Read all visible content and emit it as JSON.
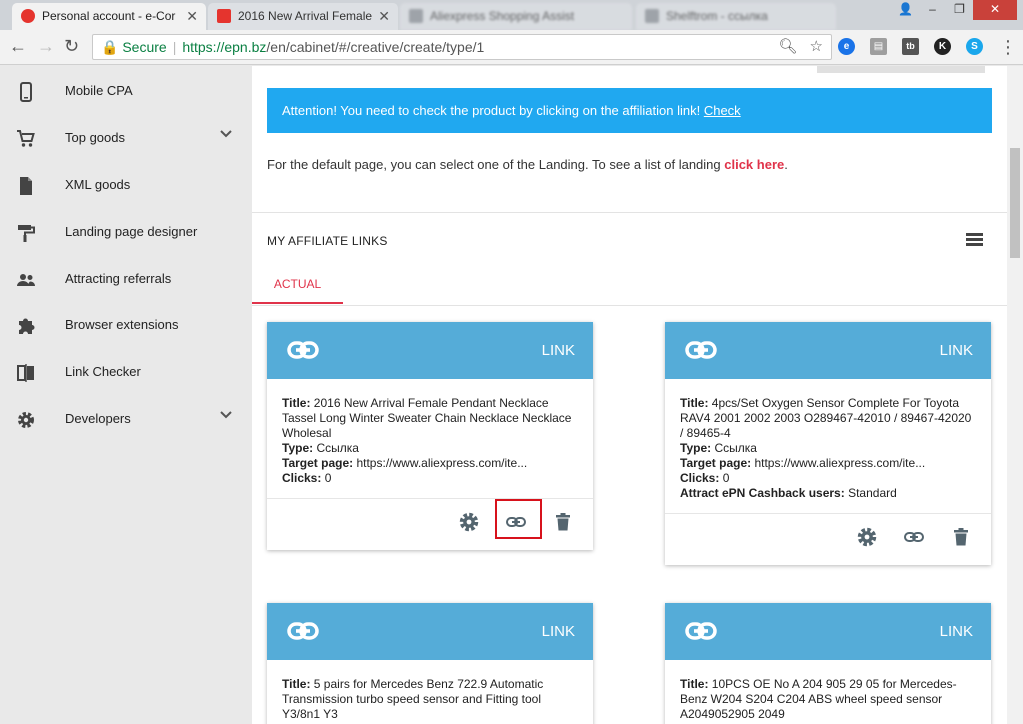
{
  "browser": {
    "tabs": [
      {
        "title": "Personal account - e-Cor",
        "active": true,
        "fav_color": "#e5342e"
      },
      {
        "title": "2016 New Arrival Female",
        "active": false,
        "fav_color": "#e5342e"
      },
      {
        "title": "Aliexpress Shopping Assist",
        "active": false,
        "blurred": true
      },
      {
        "title": "Shelftrom - ссылка",
        "active": false,
        "blurred": true
      }
    ],
    "address": {
      "secure_label": "Secure",
      "url_host": "https://epn.bz",
      "url_path": "/en/cabinet/#/creative/create/type/1"
    },
    "extensions": [
      {
        "name": "e-extension-icon",
        "label": "e",
        "color": "#1a73e8"
      },
      {
        "name": "save-extension-icon",
        "label": "▤",
        "color": "#9e9e9e"
      },
      {
        "name": "tb-extension-icon",
        "label": "tb",
        "color": "#555555"
      },
      {
        "name": "k-extension-icon",
        "label": "K",
        "color": "#222222"
      },
      {
        "name": "skype-extension-icon",
        "label": "S",
        "color": "#1aa7ec"
      }
    ]
  },
  "sidebar": {
    "items": [
      {
        "label": "Mobile CPA",
        "icon": "phone-icon",
        "expandable": false
      },
      {
        "label": "Top goods",
        "icon": "cart-icon",
        "expandable": true
      },
      {
        "label": "XML goods",
        "icon": "file-icon",
        "expandable": false
      },
      {
        "label": "Landing page designer",
        "icon": "paint-roller-icon",
        "expandable": false
      },
      {
        "label": "Attracting referrals",
        "icon": "people-icon",
        "expandable": false
      },
      {
        "label": "Browser extensions",
        "icon": "puzzle-icon",
        "expandable": false
      },
      {
        "label": "Link Checker",
        "icon": "compare-icon",
        "expandable": false
      },
      {
        "label": "Developers",
        "icon": "gear-icon",
        "expandable": true
      }
    ]
  },
  "main": {
    "alert": {
      "text": "Attention! You need to check the product by clicking on the affiliation link!",
      "link_label": "Check"
    },
    "note": {
      "text": "For the default page, you can select one of the Landing. To see a list of landing ",
      "link_label": "click here",
      "suffix": "."
    },
    "section_title": "MY AFFILIATE LINKS",
    "tab_actual": "ACTUAL",
    "cards": [
      {
        "kind": "LINK",
        "fields": [
          {
            "label": "Title:",
            "value": "2016 New Arrival Female Pendant Necklace Tassel Long Winter Sweater Chain Necklace Necklace Wholesal"
          },
          {
            "label": "Type:",
            "value": "Ссылка"
          },
          {
            "label": "Target page:",
            "value": "https://www.aliexpress.com/ite..."
          },
          {
            "label": "Clicks:",
            "value": "0"
          }
        ],
        "highlight_link": true
      },
      {
        "kind": "LINK",
        "fields": [
          {
            "label": "Title:",
            "value": "4pcs/Set Oxygen Sensor Complete For Toyota RAV4 2001 2002 2003 O289467-42010 / 89467-42020 / 89465-4"
          },
          {
            "label": "Type:",
            "value": "Ссылка"
          },
          {
            "label": "Target page:",
            "value": "https://www.aliexpress.com/ite..."
          },
          {
            "label": "Clicks:",
            "value": "0"
          },
          {
            "label": "Attract ePN Cashback users:",
            "value": "Standard"
          }
        ],
        "highlight_link": false
      },
      {
        "kind": "LINK",
        "fields": [
          {
            "label": "Title:",
            "value": "5 pairs for Mercedes Benz 722.9 Automatic Transmission turbo speed sensor and Fitting tool Y3/8n1 Y3"
          }
        ],
        "highlight_link": false
      },
      {
        "kind": "LINK",
        "fields": [
          {
            "label": "Title:",
            "value": "10PCS OE No A 204 905 29 05 for Mercedes-Benz W204 S204 C204 ABS wheel speed sensor A2049052905 2049"
          }
        ],
        "highlight_link": false
      }
    ],
    "colors": {
      "alert_bg": "#20a8f0",
      "card_header": "#55acd8",
      "accent_red": "#e0334a",
      "highlight_border": "#d7121c"
    }
  }
}
